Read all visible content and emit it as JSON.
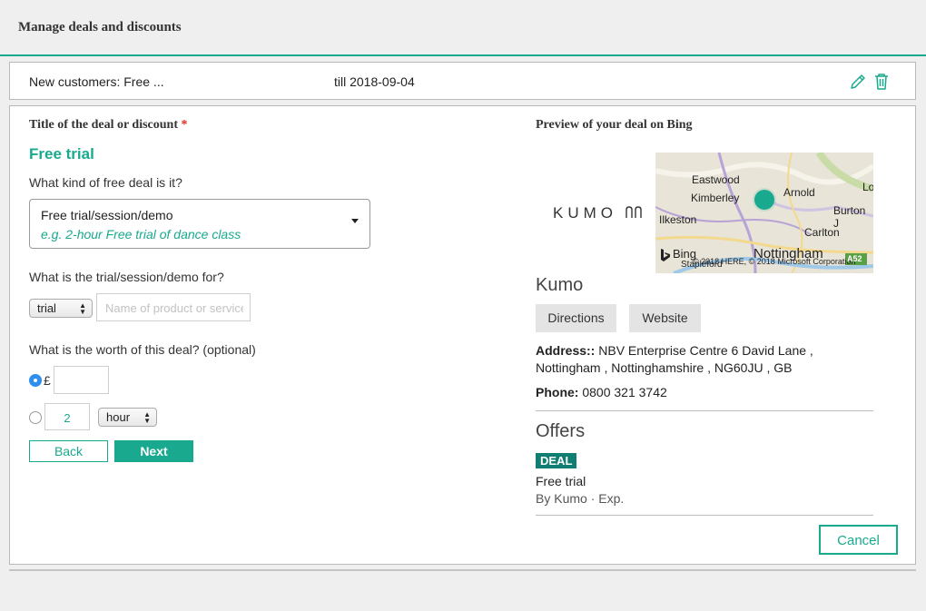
{
  "header": {
    "title": "Manage deals and discounts"
  },
  "deal_row": {
    "name": "New customers: Free ...",
    "till": "till 2018-09-04",
    "edit_icon": "pencil-icon",
    "delete_icon": "trash-icon"
  },
  "form": {
    "title_label": "Title of the deal or discount",
    "required_mark": "*",
    "deal_title": "Free trial",
    "kind_question": "What kind of free deal is it?",
    "kind_value": "Free trial/session/demo",
    "kind_hint": "e.g. 2-hour Free trial of dance class",
    "for_question": "What is the trial/session/demo for?",
    "for_type_value": "trial",
    "for_name_placeholder": "Name of product or service",
    "worth_question": "What is the worth of this deal? (optional)",
    "currency_symbol": "£",
    "duration_value": "2",
    "duration_unit": "hour",
    "back_label": "Back",
    "next_label": "Next"
  },
  "preview": {
    "title": "Preview of your deal on Bing",
    "logo_text": "KUMO",
    "map": {
      "places": [
        "Eastwood",
        "Kimberley",
        "Arnold",
        "Lo",
        "Ilkeston",
        "Burton J",
        "Carlton",
        "Nottingham",
        "Stapleford"
      ],
      "brand": "Bing",
      "copyright": "© 2018 HERE, © 2018 Microsoft Corporation",
      "road_label": "A52",
      "pin_color": "#19a98e"
    },
    "business_name": "Kumo",
    "directions_label": "Directions",
    "website_label": "Website",
    "address_label": "Address::",
    "address_value": "NBV Enterprise Centre 6 David Lane , Nottingham , Nottinghamshire , NG60JU , GB",
    "phone_label": "Phone:",
    "phone_value": "0800 321 3742",
    "offers_heading": "Offers",
    "deal_badge": "DEAL",
    "offer_title": "Free trial",
    "offer_meta": "By Kumo · Exp."
  },
  "cancel_label": "Cancel",
  "colors": {
    "accent": "#19a98e",
    "badge": "#117e73",
    "required": "#d9291c",
    "radio_selected": "#2f8ff0"
  }
}
